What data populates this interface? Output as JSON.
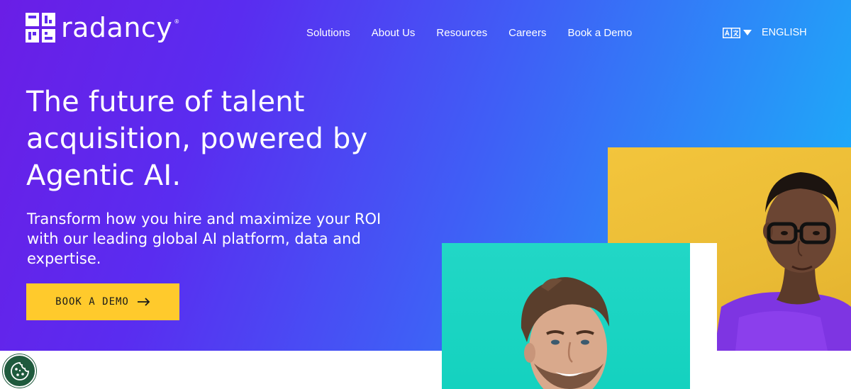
{
  "brand": {
    "name": "radancy",
    "registered_mark": "®"
  },
  "nav": {
    "items": [
      {
        "label": "Solutions"
      },
      {
        "label": "About Us"
      },
      {
        "label": "Resources"
      },
      {
        "label": "Careers"
      },
      {
        "label": "Book a Demo"
      }
    ]
  },
  "language": {
    "icon": "translate-icon",
    "label": "ENGLISH"
  },
  "hero": {
    "headline": "The future of talent acquisition, powered by Agentic AI.",
    "subtext": "Transform how you hire and maximize your ROI with our leading global AI platform, data and expertise.",
    "cta_label": "BOOK A DEMO"
  },
  "imagery": {
    "woman_photo": "portrait of smiling woman with glasses on yellow background",
    "man_photo": "portrait of smiling man on teal background"
  },
  "cookie": {
    "icon": "cookie-icon"
  },
  "colors": {
    "gradient_start": "#6a1ee6",
    "gradient_end": "#18b6f9",
    "cta": "#ffca2c",
    "yellow": "#f3c53c",
    "teal": "#14d2bf",
    "cookie_bg": "#1f5a3d"
  }
}
